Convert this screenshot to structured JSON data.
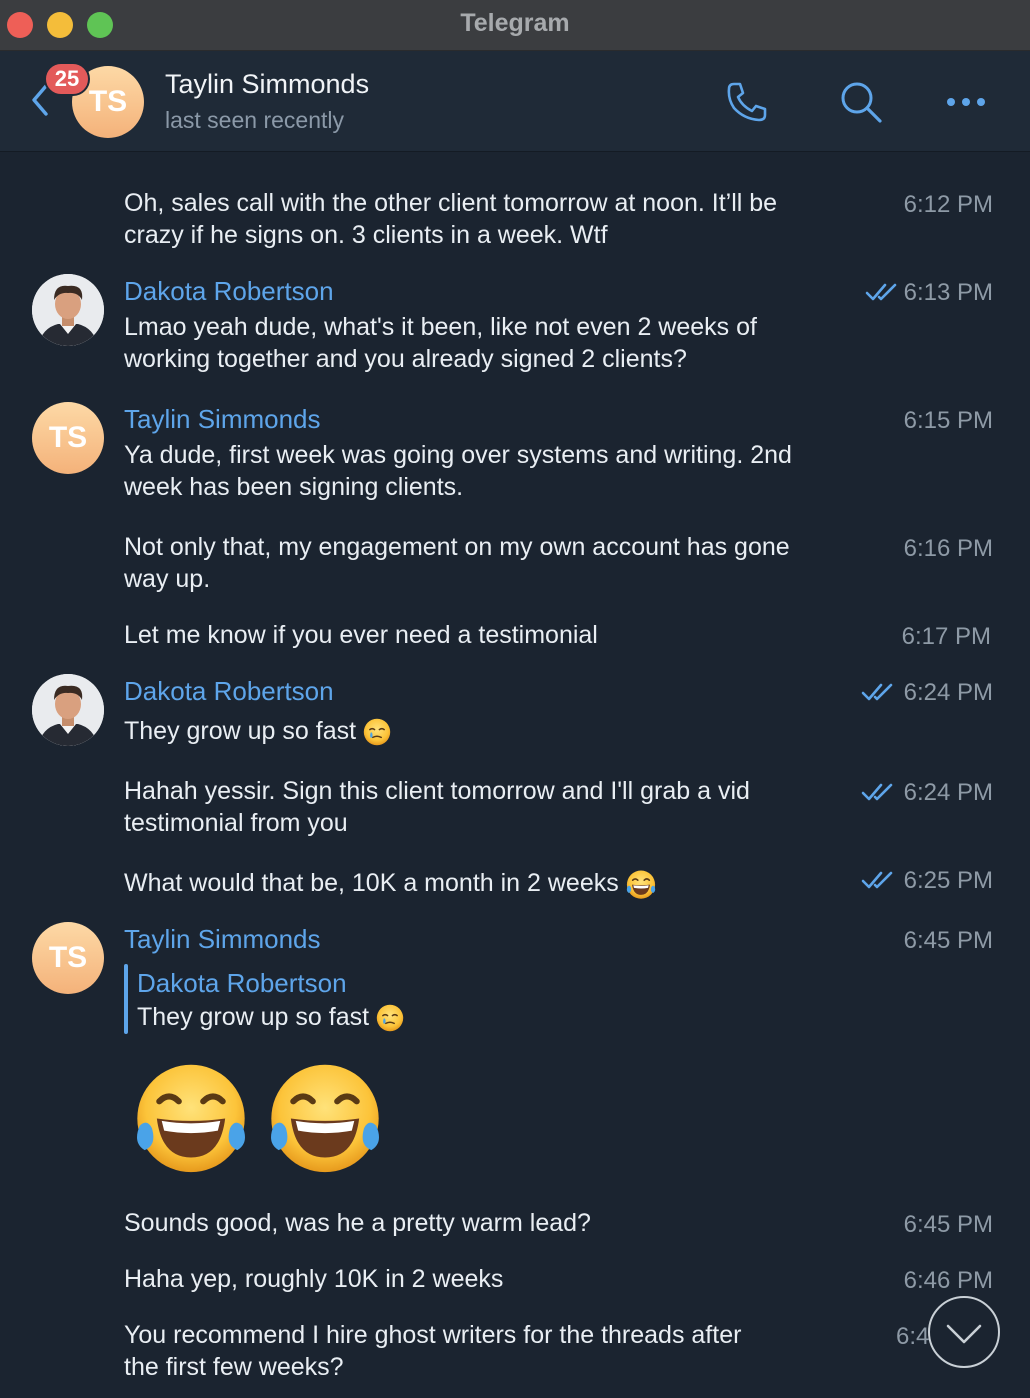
{
  "window": {
    "title": "Telegram"
  },
  "header": {
    "unread_badge": "25",
    "avatar_initials": "TS",
    "contact_name": "Taylin Simmonds",
    "status": "last seen recently"
  },
  "messages": {
    "m1": {
      "text_line1": "Oh, sales call with the other client tomorrow at noon. It’ll be",
      "text_line2": "crazy if he signs on. 3 clients in a week. Wtf",
      "time": "6:12 PM"
    },
    "m2": {
      "sender": "Dakota Robertson",
      "text_line1": "Lmao yeah dude, what's it been, like not even 2 weeks of",
      "text_line2": "working together and you already signed 2 clients?",
      "time": "6:13 PM"
    },
    "m3": {
      "sender": "Taylin Simmonds",
      "avatar_initials": "TS",
      "text_line1": "Ya dude, first week was going over systems and writing. 2nd",
      "text_line2": "week has been signing clients.",
      "time": "6:15 PM"
    },
    "m4": {
      "text_line1": "Not only that, my engagement on my own account has gone",
      "text_line2": "way up.",
      "time": "6:16 PM"
    },
    "m5": {
      "text": "Let me know if you ever need a testimonial",
      "time": "6:17 PM"
    },
    "m6": {
      "sender": "Dakota Robertson",
      "text": "They grow up so fast",
      "time": "6:24 PM"
    },
    "m7": {
      "text_line1": "Hahah yessir. Sign this client tomorrow and I'll grab a vid",
      "text_line2": "testimonial from you",
      "time": "6:24 PM"
    },
    "m8": {
      "text": "What would that be, 10K a month in 2 weeks",
      "time": "6:25 PM"
    },
    "m9": {
      "sender": "Taylin Simmonds",
      "avatar_initials": "TS",
      "reply_sender": "Dakota Robertson",
      "reply_text": "They grow up so fast",
      "time": "6:45 PM"
    },
    "m10": {
      "text": "Sounds good, was he a pretty warm lead?",
      "time": "6:45 PM"
    },
    "m11": {
      "text": "Haha yep, roughly 10K in 2 weeks",
      "time": "6:46 PM"
    },
    "m12": {
      "text_line1": "You recommend I hire ghost writers for the threads after",
      "text_line2": "the first few weeks?",
      "time": "6:4"
    }
  },
  "icons": {
    "back": "chevron-left-icon",
    "call": "phone-icon",
    "search": "search-icon",
    "more": "more-dots-icon",
    "read": "double-check-icon",
    "tears_of_joy": "face-with-tears-of-joy-emoji",
    "crying_smile": "smiling-face-with-tear-emoji",
    "scroll_down": "chevron-down-icon"
  },
  "colors": {
    "background": "#1b2430",
    "header": "#1f2a37",
    "accent": "#5ea5ea",
    "badge": "#e35a5a",
    "avatar_gradient_top": "#fdd9a6",
    "avatar_gradient_bottom": "#f4b27a"
  }
}
